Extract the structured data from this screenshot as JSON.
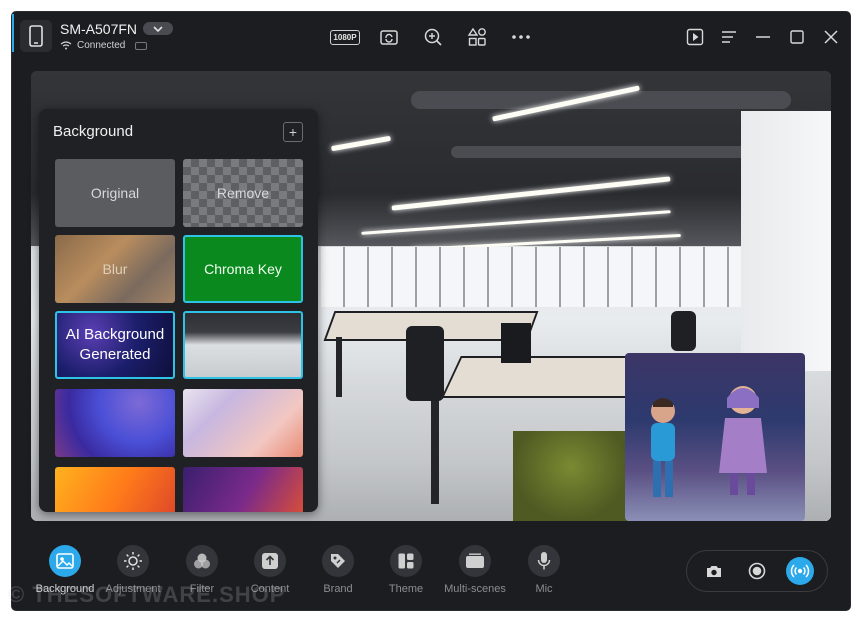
{
  "device": {
    "name": "SM-A507FN",
    "status": "Connected",
    "icon": "phone-icon"
  },
  "toolbar": {
    "resolution_badge": "1080P",
    "icons": [
      "resolution-icon",
      "rotate-camera-icon",
      "zoom-icon",
      "shapes-icon",
      "more-icon"
    ],
    "right_icons": [
      "play-icon",
      "menu-icon",
      "minimize-icon",
      "maximize-icon",
      "close-icon"
    ]
  },
  "background_panel": {
    "title": "Background",
    "add_label": "+",
    "tiles": [
      {
        "label": "Original"
      },
      {
        "label": "Remove"
      },
      {
        "label": "Blur"
      },
      {
        "label": "Chroma Key"
      },
      {
        "label": "AI Background Generated"
      },
      {
        "label": ""
      },
      {
        "label": ""
      },
      {
        "label": ""
      },
      {
        "label": ""
      },
      {
        "label": ""
      }
    ]
  },
  "bottom_tools": [
    {
      "label": "Background",
      "icon": "image-icon",
      "active": true
    },
    {
      "label": "Adjustment",
      "icon": "brightness-icon",
      "active": false
    },
    {
      "label": "Filter",
      "icon": "filter-icon",
      "active": false
    },
    {
      "label": "Content",
      "icon": "upload-icon",
      "active": false
    },
    {
      "label": "Brand",
      "icon": "tag-icon",
      "active": false
    },
    {
      "label": "Theme",
      "icon": "theme-icon",
      "active": false
    },
    {
      "label": "Multi-scenes",
      "icon": "scenes-icon",
      "active": false
    },
    {
      "label": "Mic",
      "icon": "mic-icon",
      "active": false
    }
  ],
  "capture": {
    "icons": [
      "camera-icon",
      "record-icon",
      "live-icon"
    ]
  },
  "watermark": "© THESOFTWARE.SHOP",
  "colors": {
    "accent": "#2ba9ea",
    "chroma_green": "#0a8a1e",
    "selection": "#2ec3e6",
    "window_bg": "#1c1d20"
  }
}
